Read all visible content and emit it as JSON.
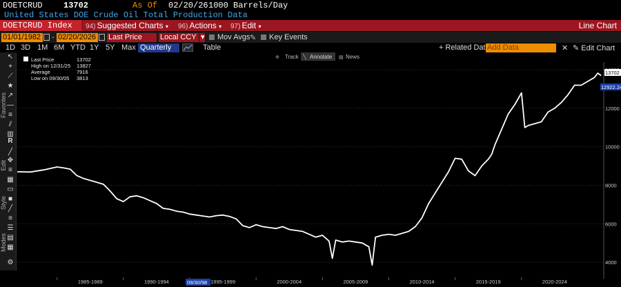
{
  "header": {
    "ticker": "DOETCRUD",
    "price": "13702",
    "as_of_label": "As Of",
    "as_of_date": "02/20/26",
    "units": "1000 Barrels/Day",
    "description": "United States DOE Crude Oil Total Production Data"
  },
  "toolbar_red": {
    "index_label": "DOETCRUD Index",
    "menus": [
      {
        "num": "94)",
        "label": "Suggested Charts"
      },
      {
        "num": "96)",
        "label": "Actions"
      },
      {
        "num": "97)",
        "label": "Edit"
      }
    ],
    "chart_type": "Line Chart"
  },
  "controls": {
    "start_date": "01/01/1982",
    "end_date": "02/20/2026",
    "field": "Last Price",
    "currency": "Local CCY",
    "mov_avgs": "Mov Avgs",
    "key_events": "Key Events"
  },
  "ranges": [
    "1D",
    "3D",
    "1M",
    "6M",
    "YTD",
    "1Y",
    "5Y",
    "Max"
  ],
  "period": "Quarterly",
  "table_label": "Table",
  "related": "+ Related Dat",
  "add_data_placeholder": "Add Data",
  "edit_chart": "Edit Chart",
  "sidebar_labels": [
    "Favorites",
    "Edit",
    "Style",
    "Modes"
  ],
  "chart_tools": [
    "Track",
    "Annotate",
    "News"
  ],
  "legend": {
    "last_label": "Last Price",
    "last_value": "13702",
    "high_label": "High on 12/31/25",
    "high_value": "13827",
    "avg_label": "Average",
    "avg_value": "7916",
    "low_label": "Low on 09/30/05",
    "low_value": "3813"
  },
  "price_tags": {
    "last": "13702",
    "crosshair": "12922.24"
  },
  "crosshair_date": "09/30/98",
  "colors": {
    "accent": "#f08c00",
    "red_bar": "#9a1620",
    "line": "#ffffff"
  },
  "chart_data": {
    "type": "line",
    "x_labels": [
      "1985-1989",
      "1990-1994",
      "1995-1999",
      "2000-2004",
      "2005-2009",
      "2010-2014",
      "2015-2019",
      "2020-2024"
    ],
    "y_ticks": [
      4000,
      6000,
      8000,
      10000,
      12000,
      14000
    ],
    "ylim": [
      3500,
      14400
    ],
    "x_range": [
      1982,
      2026.2
    ],
    "series": [
      {
        "name": "Last Price",
        "x": [
          1982.0,
          1983.0,
          1984.0,
          1985.0,
          1985.5,
          1986.0,
          1986.5,
          1987.0,
          1987.5,
          1988.0,
          1988.5,
          1989.0,
          1989.5,
          1990.0,
          1990.5,
          1991.0,
          1991.5,
          1992.0,
          1992.5,
          1993.0,
          1993.5,
          1994.0,
          1994.5,
          1995.0,
          1995.5,
          1996.0,
          1996.5,
          1997.0,
          1997.5,
          1998.0,
          1998.5,
          1999.0,
          1999.5,
          2000.0,
          2000.5,
          2001.0,
          2001.5,
          2002.0,
          2002.5,
          2003.0,
          2003.5,
          2004.0,
          2004.5,
          2005.0,
          2005.5,
          2005.75,
          2006.0,
          2006.5,
          2007.0,
          2007.5,
          2008.0,
          2008.5,
          2008.75,
          2009.0,
          2009.5,
          2010.0,
          2010.5,
          2011.0,
          2011.5,
          2012.0,
          2012.5,
          2013.0,
          2013.5,
          2014.0,
          2014.5,
          2015.0,
          2015.5,
          2016.0,
          2016.5,
          2017.0,
          2017.5,
          2017.75,
          2018.0,
          2018.5,
          2019.0,
          2019.5,
          2019.75,
          2020.0,
          2020.25,
          2020.5,
          2021.0,
          2021.5,
          2022.0,
          2022.5,
          2023.0,
          2023.5,
          2024.0,
          2024.5,
          2025.0,
          2025.5,
          2025.75,
          2026.0
        ],
        "values": [
          8700,
          8690,
          8800,
          8950,
          8900,
          8830,
          8500,
          8350,
          8250,
          8150,
          8050,
          7700,
          7300,
          7150,
          7400,
          7450,
          7350,
          7200,
          7050,
          6800,
          6750,
          6650,
          6600,
          6500,
          6450,
          6400,
          6350,
          6420,
          6450,
          6380,
          6250,
          5900,
          5800,
          5950,
          5850,
          5800,
          5750,
          5850,
          5700,
          5650,
          5600,
          5450,
          5300,
          5400,
          5100,
          4200,
          5150,
          5050,
          5100,
          5050,
          5000,
          4800,
          3850,
          5300,
          5400,
          5450,
          5400,
          5500,
          5600,
          5850,
          6300,
          7050,
          7600,
          8150,
          8700,
          9400,
          9350,
          8750,
          8500,
          9000,
          9350,
          9600,
          10100,
          10900,
          11700,
          12200,
          12500,
          12800,
          11000,
          11100,
          11200,
          11300,
          11800,
          12000,
          12300,
          12700,
          13200,
          13200,
          13400,
          13600,
          13827,
          13702
        ]
      }
    ]
  }
}
